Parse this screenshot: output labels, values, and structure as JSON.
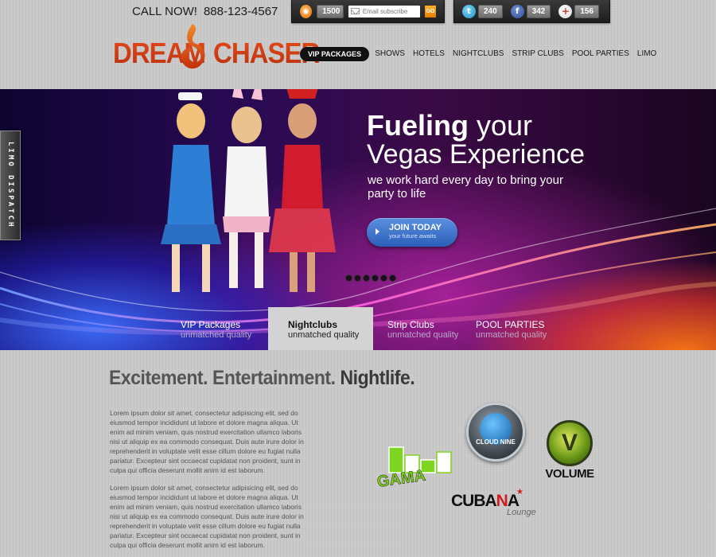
{
  "header": {
    "call_label": "CALL NOW!",
    "phone": "888-123-4567"
  },
  "social": {
    "rss_count": "1500",
    "subscribe_placeholder": "Email subscribe",
    "go_label": "GO",
    "twitter_count": "240",
    "facebook_count": "342",
    "googleplus_count": "156"
  },
  "logo": {
    "word1": "DREAM",
    "word2": "CHASER"
  },
  "nav": {
    "items": [
      "VIP PACKAGES",
      "SHOWS",
      "HOTELS",
      "NIGHTCLUBS",
      "STRIP CLUBS",
      "POOL PARTIES",
      "LIMO"
    ]
  },
  "limo_tab": "LIMO DISPATCH",
  "hero": {
    "title_bold": "Fueling",
    "title_rest": " your",
    "title_line2": "Vegas Experience",
    "subtitle": "we work hard every day to bring your party to life",
    "join_title": "JOIN TODAY",
    "join_sub": "your future awaits",
    "slide_count": 6,
    "tabs": [
      {
        "title": "VIP Packages",
        "sub": "unmatched quality"
      },
      {
        "title": "Nightclubs",
        "sub": "unmatched quality"
      },
      {
        "title": "Strip Clubs",
        "sub": "unmatched quality"
      },
      {
        "title": "POOL PARTIES",
        "sub": "unmatched quality"
      }
    ]
  },
  "content": {
    "headline_part1": "Excitement. Entertainment. ",
    "headline_bold": "Nightlife.",
    "paragraph1": "Lorem ipsum dolor sit amet, consectetur adipisicing elit, sed do eiusmod tempor incididunt ut labore et dolore magna aliqua. Ut enim ad minim veniam, quis nostrud exercitation ullamco laboris nisi ut aliquip ex ea commodo consequat. Duis aute irure dolor in reprehenderit in voluptate velit esse cillum dolore eu fugiat nulla pariatur. Excepteur sint occaecat cupidatat non proident, sunt in culpa qui officia deserunt mollit anim id est laborum.",
    "paragraph2": "Lorem ipsum dolor sit amet, consectetur adipisicing elit, sed do eiusmod tempor incididunt ut labore et dolore magna aliqua. Ut enim ad minim veniam, quis nostrud exercitation ullamco laboris nisi ut aliquip ex ea commodo consequat. Duis aute irure dolor in reprehenderit in voluptate velit esse cillum dolore eu fugiat nulla pariatur. Excepteur sint occaecat cupidatat non proident, sunt in culpa qui officia deserunt mollit anim id est laborum."
  },
  "clubs": {
    "gama": "GAMA",
    "cloud": "CLOUD NINE",
    "volume": "VOLUME",
    "cubana_a": "CUBA",
    "cubana_b": "N",
    "cubana_c": "A",
    "cubana_sub": "Lounge"
  },
  "colors": {
    "brand": "#d9431b",
    "join_button": "#3a6fcc",
    "nav_active": "#111111"
  }
}
